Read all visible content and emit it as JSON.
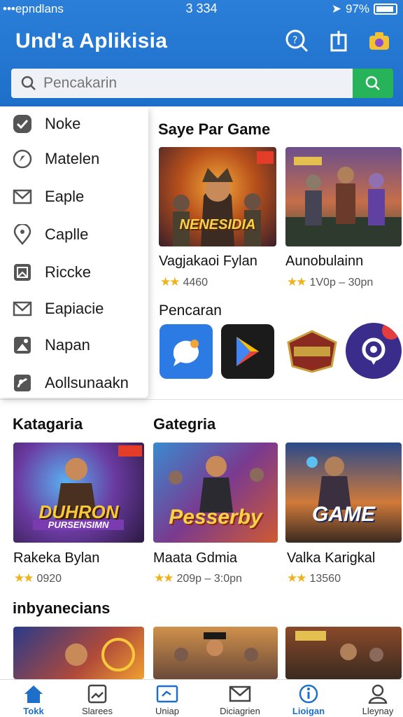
{
  "status_bar": {
    "carrier": "•••epndlans",
    "time": "3 334",
    "battery": "97%"
  },
  "header": {
    "title": "Und'a Aplikisia"
  },
  "search": {
    "placeholder": "Pencakarin"
  },
  "dropdown": {
    "items": [
      {
        "label": "Noke",
        "icon": "check-icon"
      },
      {
        "label": "Matelen",
        "icon": "compass-icon"
      },
      {
        "label": "Eaple",
        "icon": "mail-icon"
      },
      {
        "label": "Caplle",
        "icon": "location-pin-icon"
      },
      {
        "label": "Riccke",
        "icon": "image-icon"
      },
      {
        "label": "Eapiacie",
        "icon": "envelope-icon"
      },
      {
        "label": "Napan",
        "icon": "photo-icon"
      },
      {
        "label": "Aollsunaakn",
        "icon": "gallery-icon"
      }
    ]
  },
  "featured": {
    "title": "Saye Par Game",
    "cards": [
      {
        "title": "Vagjakaoi Fylan",
        "meta": "4460",
        "art": "NENESIDIA"
      },
      {
        "title": "Aunobulainn",
        "meta": "1V0p – 30pn",
        "art": ""
      }
    ]
  },
  "pencaran": {
    "title": "Pencaran"
  },
  "categories": {
    "left_title": "Katagaria",
    "right_title": "Gategria",
    "cards": [
      {
        "title": "Rakeka Bylan",
        "meta": "0920",
        "art": "DUHRON",
        "art_sub": "PURSENSIMN"
      },
      {
        "title": "Maata Gdmia",
        "meta": "209p – 3:0pn",
        "art": "Pesserby"
      },
      {
        "title": "Valka Karigkal",
        "meta": "13560",
        "art": "GAME"
      }
    ]
  },
  "recommended": {
    "title": "inbyanecians"
  },
  "bottom_nav": {
    "items": [
      {
        "label": "Tokk",
        "icon": "home-icon"
      },
      {
        "label": "Slarees",
        "icon": "image-icon"
      },
      {
        "label": "Uniap",
        "icon": "ticket-icon"
      },
      {
        "label": "Diciagrien",
        "icon": "mail-icon"
      },
      {
        "label": "Lioigan",
        "icon": "info-icon"
      },
      {
        "label": "Lleynay",
        "icon": "user-icon"
      }
    ]
  },
  "colors": {
    "header_blue": "#1e6fc9",
    "search_green": "#27b35a",
    "star": "#f0b21b"
  }
}
